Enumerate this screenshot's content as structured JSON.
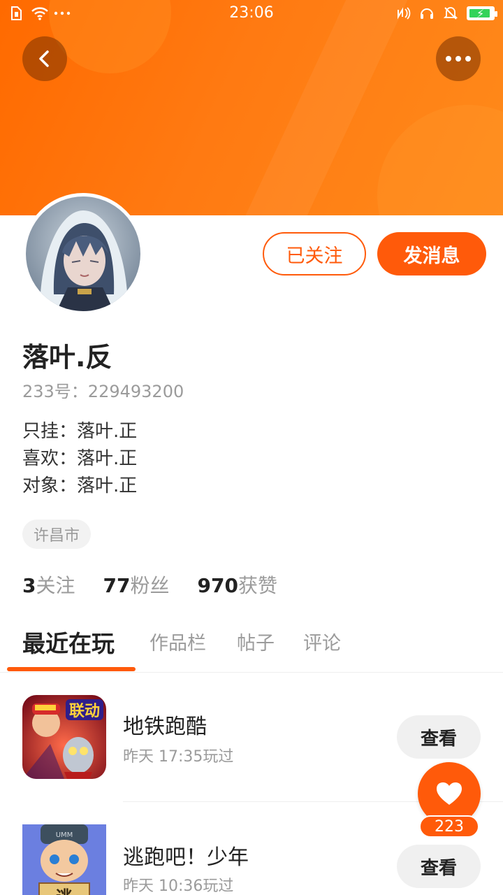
{
  "status_bar": {
    "time": "23:06",
    "left_icons": [
      "sim-card-icon",
      "wifi-icon",
      "more-dots-icon"
    ],
    "right_icons": [
      "nfc-icon",
      "headset-icon",
      "mute-icon",
      "battery-icon"
    ],
    "battery_level": 0.9,
    "battery_color": "#33d35a"
  },
  "header": {
    "back_icon": "chevron-left-icon",
    "more_icon": "more-horizontal-icon",
    "banner_color": "#ff6a00"
  },
  "profile": {
    "username": "落叶.反",
    "user_id": "233号：229493200",
    "bio": [
      "只挂：落叶.正",
      "喜欢：落叶.正",
      "对象：落叶.正"
    ],
    "location": "许昌市",
    "follow_button": "已关注",
    "message_button": "发消息"
  },
  "stats": {
    "following_count": "3",
    "following_label": "关注",
    "fans_count": "77",
    "fans_label": "粉丝",
    "likes_count": "970",
    "likes_label": "获赞"
  },
  "tabs": [
    {
      "label": "最近在玩",
      "active": true
    },
    {
      "label": "作品栏",
      "active": false
    },
    {
      "label": "帖子",
      "active": false
    },
    {
      "label": "评论",
      "active": false
    }
  ],
  "games": [
    {
      "name": "地铁跑酷",
      "time": "昨天 17:35玩过",
      "button": "查看",
      "icon_badge": "联动"
    },
    {
      "name": "逃跑吧！少年",
      "time": "昨天 10:36玩过",
      "button": "查看",
      "icon_badge": "逃"
    }
  ],
  "like_fab": {
    "icon": "heart-icon",
    "count": "223"
  },
  "accent_color": "#ff5a0a"
}
